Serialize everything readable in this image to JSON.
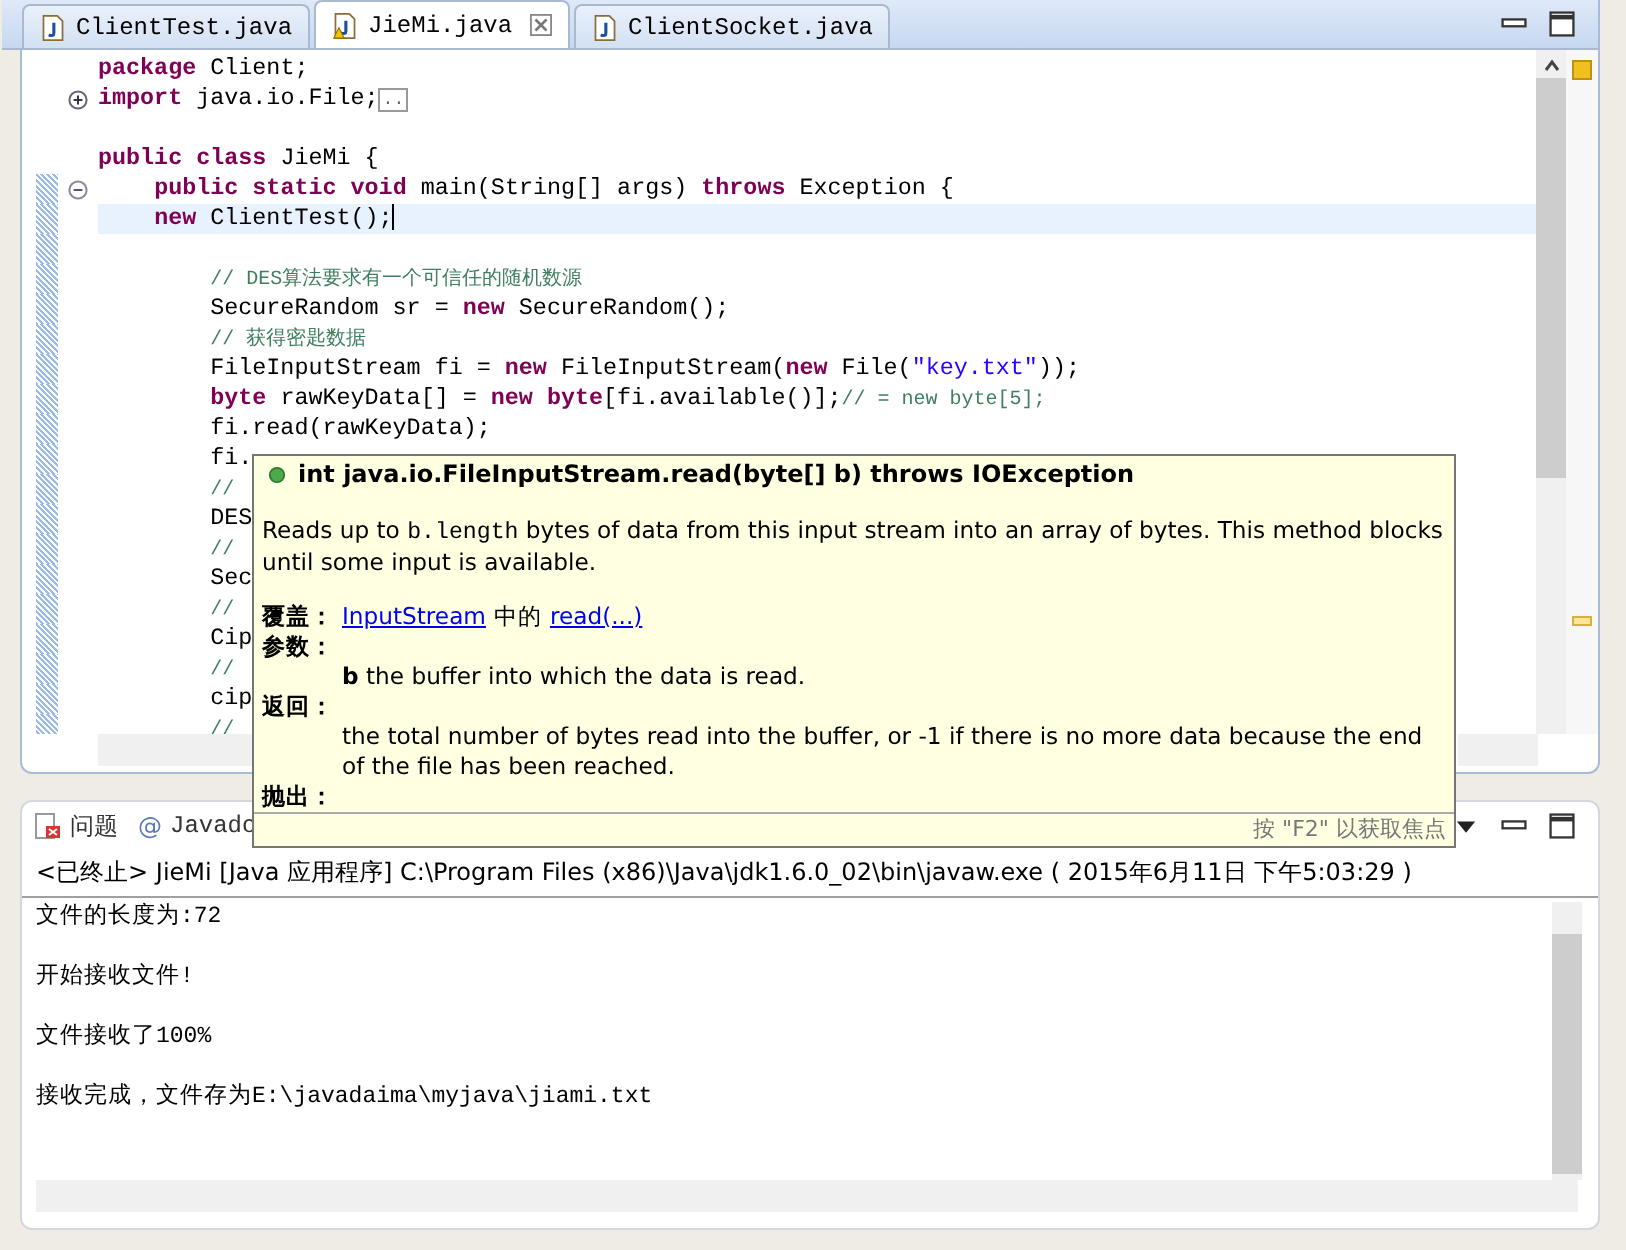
{
  "editor": {
    "tabs": [
      {
        "label": "ClientTest.java",
        "selected": false,
        "warning": false,
        "closable": false
      },
      {
        "label": "JieMi.java",
        "selected": true,
        "warning": true,
        "closable": true
      },
      {
        "label": "ClientSocket.java",
        "selected": false,
        "warning": false,
        "closable": false
      }
    ],
    "lines": [
      {
        "changed": false,
        "current": false,
        "segments": [
          {
            "kind": "keyword",
            "text": "package"
          },
          {
            "kind": "plain",
            "text": " Client;"
          }
        ]
      },
      {
        "expandable": true,
        "changed": false,
        "current": false,
        "segments": [
          {
            "kind": "keyword",
            "text": "import"
          },
          {
            "kind": "plain",
            "text": " java.io.File;"
          },
          {
            "kind": "folded",
            "text": ".."
          }
        ]
      },
      {
        "changed": false
      },
      {
        "changed": false,
        "current": false,
        "segments": [
          {
            "kind": "keyword",
            "text": "public "
          },
          {
            "kind": "keyword",
            "text": "class"
          },
          {
            "kind": "plain",
            "text": " JieMi {"
          }
        ]
      },
      {
        "collapsible": true,
        "changed": true,
        "current": false,
        "segments": [
          {
            "kind": "keyword",
            "text": "    public "
          },
          {
            "kind": "keyword",
            "text": "static "
          },
          {
            "kind": "keyword",
            "text": "void"
          },
          {
            "kind": "plain",
            "text": " main(String[] args) "
          },
          {
            "kind": "keyword",
            "text": "throws"
          },
          {
            "kind": "plain",
            "text": " Exception {"
          }
        ]
      },
      {
        "changed": true,
        "current": true,
        "segments": [
          {
            "kind": "keyword",
            "text": "    new"
          },
          {
            "kind": "plain",
            "text": " ClientTest();"
          }
        ]
      },
      {
        "changed": true
      },
      {
        "changed": true,
        "current": false,
        "segments": [
          {
            "kind": "comment",
            "text": "        // DES算法要求有一个可信任的随机数源"
          }
        ]
      },
      {
        "changed": true,
        "current": false,
        "segments": [
          {
            "kind": "plain",
            "text": "        SecureRandom sr = "
          },
          {
            "kind": "keyword",
            "text": "new"
          },
          {
            "kind": "plain",
            "text": " SecureRandom();"
          }
        ]
      },
      {
        "changed": true,
        "current": false,
        "segments": [
          {
            "kind": "comment",
            "text": "        // 获得密匙数据"
          }
        ]
      },
      {
        "changed": true,
        "current": false,
        "segments": [
          {
            "kind": "plain",
            "text": "        FileInputStream fi = "
          },
          {
            "kind": "keyword",
            "text": "new"
          },
          {
            "kind": "plain",
            "text": " FileInputStream("
          },
          {
            "kind": "keyword",
            "text": "new"
          },
          {
            "kind": "plain",
            "text": " File("
          },
          {
            "kind": "string",
            "text": "\"key.txt\""
          },
          {
            "kind": "plain",
            "text": "));"
          }
        ]
      },
      {
        "changed": true,
        "current": false,
        "segments": [
          {
            "kind": "keyword",
            "text": "        byte"
          },
          {
            "kind": "plain",
            "text": " rawKeyData[] = "
          },
          {
            "kind": "keyword",
            "text": "new "
          },
          {
            "kind": "keyword",
            "text": "byte"
          },
          {
            "kind": "plain",
            "text": "[fi.available()];"
          },
          {
            "kind": "comment",
            "text": "// = new byte[5];"
          }
        ]
      },
      {
        "changed": true,
        "current": false,
        "segments": [
          {
            "kind": "plain",
            "text": "        fi.read(rawKeyData);"
          }
        ]
      },
      {
        "changed": true,
        "current": false,
        "segments": [
          {
            "kind": "plain",
            "text": "        fi."
          }
        ]
      },
      {
        "changed": true,
        "current": false,
        "segments": [
          {
            "kind": "comment",
            "text": "        //"
          }
        ]
      },
      {
        "changed": true,
        "current": false,
        "segments": [
          {
            "kind": "plain",
            "text": "        DES"
          }
        ]
      },
      {
        "changed": true,
        "current": false,
        "segments": [
          {
            "kind": "comment",
            "text": "        //"
          }
        ]
      },
      {
        "changed": true,
        "current": false,
        "segments": [
          {
            "kind": "plain",
            "text": "        Sec"
          }
        ]
      },
      {
        "changed": true,
        "current": false,
        "segments": [
          {
            "kind": "comment",
            "text": "        //"
          }
        ]
      },
      {
        "changed": true,
        "current": false,
        "segments": [
          {
            "kind": "plain",
            "text": "        Cip"
          }
        ]
      },
      {
        "changed": true,
        "current": false,
        "segments": [
          {
            "kind": "comment",
            "text": "        //"
          }
        ]
      },
      {
        "changed": true,
        "current": false,
        "segments": [
          {
            "kind": "plain",
            "text": "        cip"
          }
        ]
      },
      {
        "changed": true,
        "current": false,
        "segments": [
          {
            "kind": "comment",
            "text": "        //"
          }
        ]
      }
    ]
  },
  "tooltip": {
    "title": "int java.io.FileInputStream.read(byte[] b) throws IOException",
    "description": [
      {
        "kind": "plain",
        "text": "Reads up to "
      },
      {
        "kind": "code",
        "text": "b.length"
      },
      {
        "kind": "plain",
        "text": " bytes of data from this input stream into an array of bytes. This method blocks until some input is available."
      }
    ],
    "overrides": {
      "label": "覆盖：",
      "link_1": "InputStream",
      "middle": "中的",
      "link_2": "read(...)"
    },
    "params": {
      "label": "参数：",
      "text": "**b** the buffer into which the data is read."
    },
    "returns": {
      "label": "返回：",
      "text": "the total number of bytes read into the buffer, or -1 if there is no more data because the end of the file has been reached."
    },
    "throws": {
      "label": "抛出："
    },
    "footer": "按 \"F2\" 以获取焦点"
  },
  "console": {
    "tabs": [
      {
        "kind": "problems",
        "label": "问题"
      },
      {
        "kind": "javadoc",
        "symbol": "@",
        "label": "Javado"
      }
    ],
    "header": "<已终止> JieMi [Java 应用程序] C:\\Program Files (x86)\\Java\\jdk1.6.0_02\\bin\\javaw.exe ( 2015年6月11日 下午5:03:29 )",
    "lines": [
      "文件的长度为:72",
      "开始接收文件!",
      "文件接收了100%",
      "接收完成，文件存为E:\\javadaima\\myjava\\jiami.txt"
    ]
  }
}
